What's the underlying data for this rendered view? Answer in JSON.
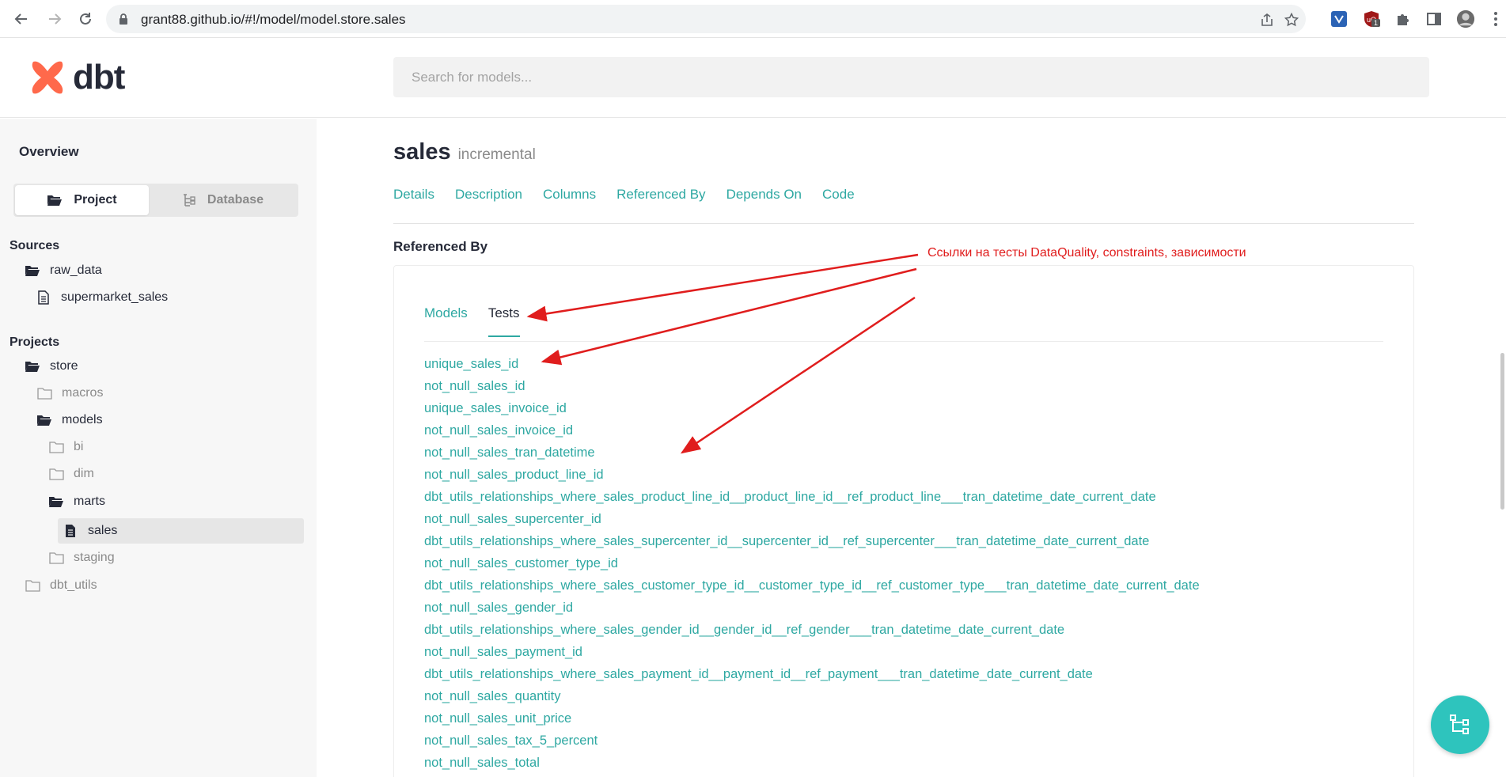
{
  "browser": {
    "url": "grant88.github.io/#!/model/model.store.sales",
    "extension_badge": "1"
  },
  "header": {
    "logo_text": "dbt",
    "search_placeholder": "Search for models..."
  },
  "sidebar": {
    "overview_label": "Overview",
    "toggle": {
      "project_label": "Project",
      "database_label": "Database",
      "active": "Project"
    },
    "sources_label": "Sources",
    "sources": [
      {
        "label": "raw_data",
        "type": "folder-open"
      },
      {
        "label": "supermarket_sales",
        "type": "file"
      }
    ],
    "projects_label": "Projects",
    "projects": [
      {
        "label": "store",
        "type": "folder-open"
      },
      {
        "label": "macros",
        "type": "folder"
      },
      {
        "label": "models",
        "type": "folder-open"
      },
      {
        "label": "bi",
        "type": "folder"
      },
      {
        "label": "dim",
        "type": "folder"
      },
      {
        "label": "marts",
        "type": "folder-open"
      },
      {
        "label": "sales",
        "type": "file",
        "selected": true
      },
      {
        "label": "staging",
        "type": "folder"
      },
      {
        "label": "dbt_utils",
        "type": "folder"
      }
    ]
  },
  "main": {
    "model_name": "sales",
    "materialization": "incremental",
    "tabs": [
      "Details",
      "Description",
      "Columns",
      "Referenced By",
      "Depends On",
      "Code"
    ],
    "section_title": "Referenced By",
    "subtabs": {
      "models_label": "Models",
      "tests_label": "Tests",
      "active": "Tests"
    },
    "tests": [
      "unique_sales_id",
      "not_null_sales_id",
      "unique_sales_invoice_id",
      "not_null_sales_invoice_id",
      "not_null_sales_tran_datetime",
      "not_null_sales_product_line_id",
      "dbt_utils_relationships_where_sales_product_line_id__product_line_id__ref_product_line___tran_datetime_date_current_date",
      "not_null_sales_supercenter_id",
      "dbt_utils_relationships_where_sales_supercenter_id__supercenter_id__ref_supercenter___tran_datetime_date_current_date",
      "not_null_sales_customer_type_id",
      "dbt_utils_relationships_where_sales_customer_type_id__customer_type_id__ref_customer_type___tran_datetime_date_current_date",
      "not_null_sales_gender_id",
      "dbt_utils_relationships_where_sales_gender_id__gender_id__ref_gender___tran_datetime_date_current_date",
      "not_null_sales_payment_id",
      "dbt_utils_relationships_where_sales_payment_id__payment_id__ref_payment___tran_datetime_date_current_date",
      "not_null_sales_quantity",
      "not_null_sales_unit_price",
      "not_null_sales_tax_5_percent",
      "not_null_sales_total"
    ]
  },
  "annotation": {
    "text": "Ссылки на тесты DataQuality, constraints, зависимости",
    "color": "#e01d1d"
  },
  "colors": {
    "accent": "#2ea8a2",
    "logo": "#ff694b",
    "fab": "#2ec4bd"
  }
}
